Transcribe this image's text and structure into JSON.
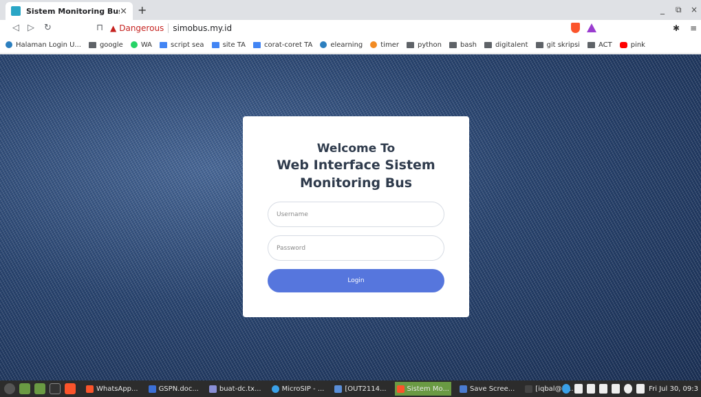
{
  "browser": {
    "tab_title": "Sistem Monitoring Bus",
    "tab_close": "×",
    "new_tab": "+",
    "security_label": "Dangerous",
    "url": "simobus.my.id",
    "window_minimize": "_",
    "window_restore": "⧉",
    "window_close": "×",
    "colors": {
      "tab_bar": "#dfe1e5",
      "danger": "#c5221f"
    }
  },
  "bookmarks": [
    {
      "label": "Halaman Login U...",
      "icon": "site-icon"
    },
    {
      "label": "google",
      "icon": "folder-icon"
    },
    {
      "label": "WA",
      "icon": "whatsapp-icon"
    },
    {
      "label": "script sea",
      "icon": "docs-icon"
    },
    {
      "label": "site TA",
      "icon": "sites-icon"
    },
    {
      "label": "corat-coret TA",
      "icon": "docs-icon"
    },
    {
      "label": "elearning",
      "icon": "site-icon"
    },
    {
      "label": "timer",
      "icon": "timer-icon"
    },
    {
      "label": "python",
      "icon": "folder-icon"
    },
    {
      "label": "bash",
      "icon": "folder-icon"
    },
    {
      "label": "digitalent",
      "icon": "folder-icon"
    },
    {
      "label": "git skripsi",
      "icon": "folder-icon"
    },
    {
      "label": "ACT",
      "icon": "folder-icon"
    },
    {
      "label": "pink",
      "icon": "youtube-icon"
    }
  ],
  "login": {
    "welcome_line1": "Welcome To",
    "welcome_line2": "Web Interface Sistem",
    "welcome_line3": "Monitoring Bus",
    "username_placeholder": "Username",
    "password_placeholder": "Password",
    "login_label": "Login",
    "colors": {
      "button": "#5676dd",
      "heading": "#2f3b4c"
    }
  },
  "taskbar": {
    "tasks": [
      {
        "label": "WhatsApp...",
        "active": false
      },
      {
        "label": "GSPN.doc...",
        "active": false
      },
      {
        "label": "buat-dc.tx...",
        "active": false
      },
      {
        "label": "MicroSIP - ...",
        "active": false
      },
      {
        "label": "[OUT2114...",
        "active": false
      },
      {
        "label": "Sistem Mo...",
        "active": true
      },
      {
        "label": "Save Scree...",
        "active": false
      },
      {
        "label": "[iqbal@N...",
        "active": false
      }
    ],
    "clock": "Fri Jul 30, 09:3"
  }
}
